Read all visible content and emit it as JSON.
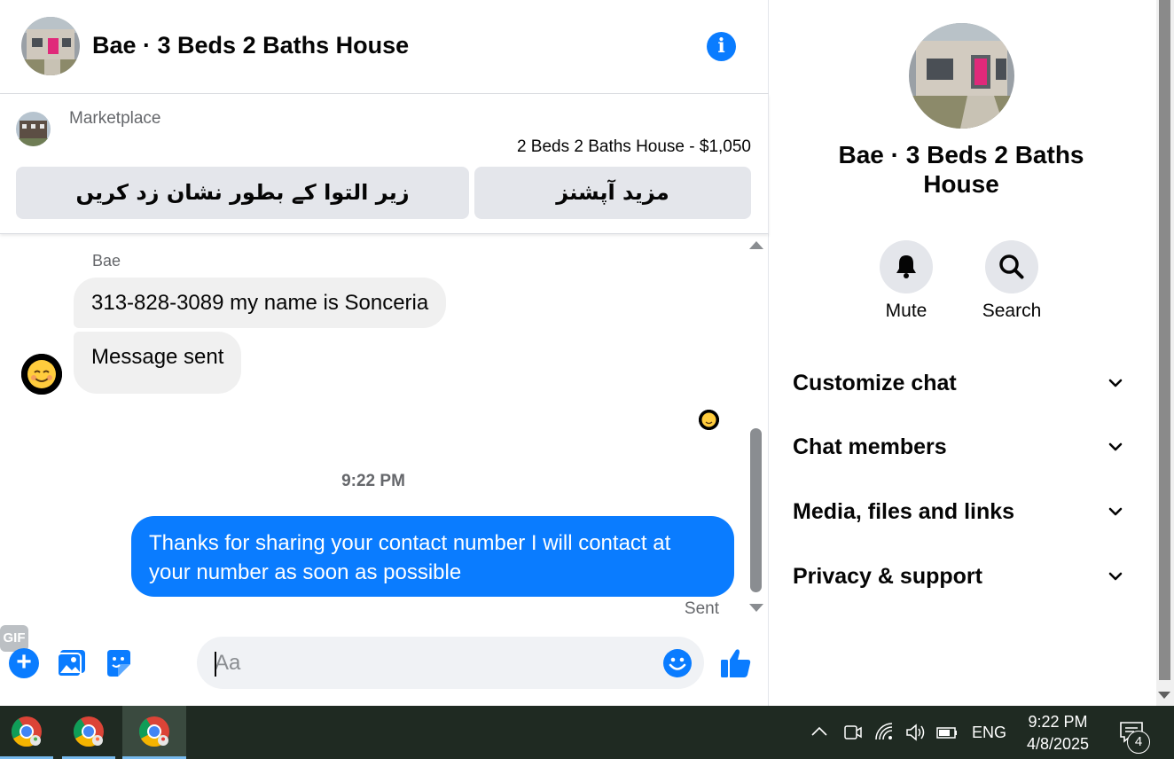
{
  "chat": {
    "title": "Bae · 3 Beds 2 Baths House",
    "marketplace": {
      "label": "Marketplace",
      "listing": "2 Beds 2 Baths House - $1,050",
      "mark_pending_button": "زیر التوا کے بطور نشان زد کریں",
      "more_options_button": "مزید آپشنز"
    },
    "messages": {
      "sender_name": "Bae",
      "incoming": [
        "313-828-3089 my name is Sonceria",
        "Message sent"
      ],
      "time_separator": "9:22 PM",
      "outgoing": "Thanks for sharing your contact number I will contact at your number as soon as possible",
      "status": "Sent"
    },
    "composer": {
      "placeholder": "Aa",
      "gif_label": "GIF"
    }
  },
  "details": {
    "title": "Bae · 3 Beds 2 Baths House",
    "actions": [
      {
        "label": "Mute",
        "icon": "bell-icon"
      },
      {
        "label": "Search",
        "icon": "search-icon"
      }
    ],
    "sections": [
      "Customize chat",
      "Chat members",
      "Media, files and links",
      "Privacy & support"
    ]
  },
  "taskbar": {
    "language": "ENG",
    "time": "9:22 PM",
    "date": "4/8/2025",
    "notification_count": "4"
  },
  "colors": {
    "accent": "#0a7cff",
    "bubble_incoming": "#f0f0f0",
    "taskbar": "#1f2a22"
  }
}
